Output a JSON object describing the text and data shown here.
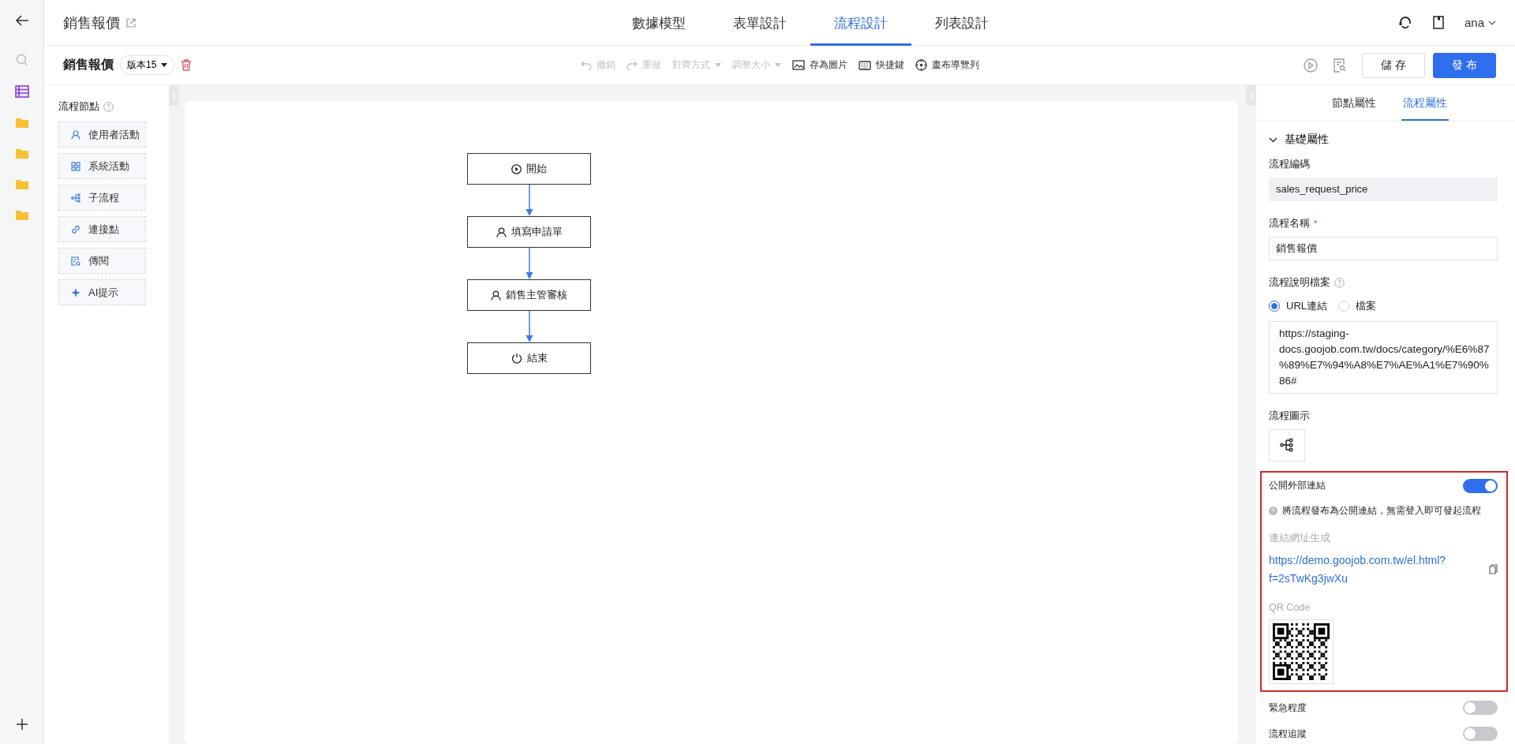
{
  "header": {
    "title": "銷售報價",
    "tabs": [
      {
        "label": "數據模型",
        "selected": false
      },
      {
        "label": "表單設計",
        "selected": false
      },
      {
        "label": "流程設計",
        "selected": true
      },
      {
        "label": "列表設計",
        "selected": false
      }
    ],
    "user": "ana"
  },
  "toolbar": {
    "process_name": "銷售報價",
    "version": "版本15",
    "tools": [
      {
        "label": "撤銷",
        "kind": "undo",
        "disabled": true,
        "dropdown": false
      },
      {
        "label": "重做",
        "kind": "redo",
        "disabled": true,
        "dropdown": false
      },
      {
        "label": "對齊方式",
        "kind": "none",
        "disabled": true,
        "dropdown": true
      },
      {
        "label": "調整大小",
        "kind": "none",
        "disabled": true,
        "dropdown": true
      },
      {
        "label": "存為圖片",
        "kind": "image",
        "disabled": false,
        "dropdown": false
      },
      {
        "label": "快捷鍵",
        "kind": "keyboard",
        "disabled": false,
        "dropdown": false
      },
      {
        "label": "畫布導覽列",
        "kind": "compass",
        "disabled": false,
        "dropdown": false
      }
    ],
    "buttons": [
      {
        "label": "儲 存",
        "kind": "secondary"
      },
      {
        "label": "發 布",
        "kind": "primary"
      }
    ]
  },
  "palette": {
    "title": "流程節點",
    "items": [
      {
        "label": "使用者活動",
        "kind": "user"
      },
      {
        "label": "系統活動",
        "kind": "system"
      },
      {
        "label": "子流程",
        "kind": "subflow"
      },
      {
        "label": "連接點",
        "kind": "link"
      },
      {
        "label": "傳閱",
        "kind": "circulate"
      },
      {
        "label": "AI提示",
        "kind": "ai"
      }
    ]
  },
  "flow": {
    "nodes": [
      {
        "label": "開始",
        "kind": "start"
      },
      {
        "label": "填寫申請單",
        "kind": "user"
      },
      {
        "label": "銷售主管審核",
        "kind": "user"
      },
      {
        "label": "結束",
        "kind": "end"
      }
    ]
  },
  "panel": {
    "tabs": [
      {
        "label": "節點屬性",
        "selected": false
      },
      {
        "label": "流程屬性",
        "selected": true
      }
    ],
    "section": {
      "title": "基礎屬性",
      "expanded": true
    },
    "code": {
      "label": "流程編碼",
      "value": "sales_request_price"
    },
    "name": {
      "label": "流程名稱",
      "required_mark": "*",
      "value": "銷售報價"
    },
    "doc": {
      "label": "流程說明檔案",
      "options": [
        {
          "label": "URL連結",
          "selected": true
        },
        {
          "label": "檔案",
          "selected": false
        }
      ],
      "value": "https://staging-docs.goojob.com.tw/docs/category/%E6%87%89%E7%94%A8%E7%AE%A1%E7%90%86#"
    },
    "icon_label": "流程圖示",
    "public_link": {
      "label": "公開外部連結",
      "on": true,
      "hint": "將流程發布為公開連結，無需登入即可發起流程",
      "url_label": "連結網址生成",
      "url": "https://demo.goojob.com.tw/el.html?f=2sTwKg3jwXu",
      "qr_label": "QR Code"
    },
    "switches": [
      {
        "label": "緊急程度",
        "on": false
      },
      {
        "label": "流程追蹤",
        "on": false
      }
    ]
  }
}
